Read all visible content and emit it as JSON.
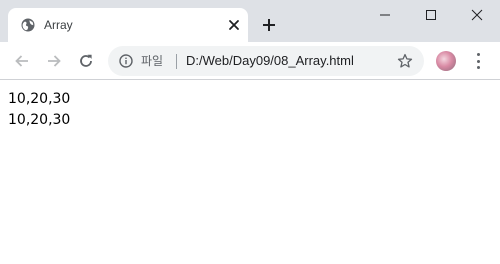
{
  "window": {
    "tab_title": "Array",
    "tab_icon": "globe-icon",
    "close_tab_icon": "close-icon",
    "new_tab_icon": "plus-icon",
    "controls": [
      "minimize-icon",
      "maximize-icon",
      "close-icon"
    ],
    "titlebar_color": "#dee1e6"
  },
  "toolbar": {
    "back_icon": "arrow-left-icon",
    "forward_icon": "arrow-right-icon",
    "reload_icon": "reload-icon",
    "info_icon": "info-icon",
    "scheme_label": "파일",
    "url": "D:/Web/Day09/08_Array.html",
    "bookmark_icon": "star-icon",
    "profile_icon": "avatar",
    "menu_icon": "more-vertical-icon"
  },
  "content": {
    "lines": [
      "10,20,30",
      "10,20,30"
    ]
  }
}
